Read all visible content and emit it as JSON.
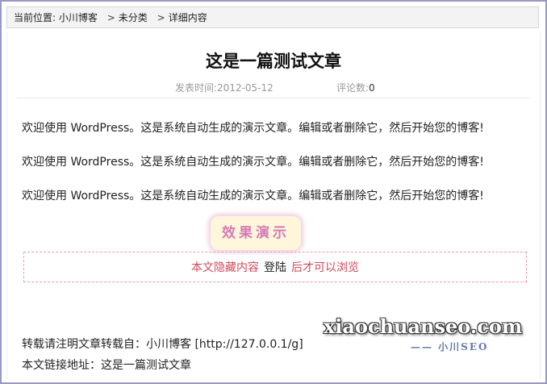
{
  "breadcrumb": {
    "prefix": "当前位置:",
    "home": "小川博客",
    "sep": ">",
    "category": "未分类",
    "current": "详细内容"
  },
  "article": {
    "title": "这是一篇测试文章",
    "date_label": "发表时间:",
    "date_value": "2012-05-12",
    "comments_label": "评论数:",
    "comments_value": "0",
    "paragraphs": [
      "欢迎使用 WordPress。这是系统自动生成的演示文章。编辑或者删除它，然后开始您的博客!",
      "欢迎使用 WordPress。这是系统自动生成的演示文章。编辑或者删除它，然后开始您的博客!",
      "欢迎使用 WordPress。这是系统自动生成的演示文章。编辑或者删除它，然后开始您的博客!"
    ],
    "demo_button": "效果演示",
    "hidden_prefix": "本文隐藏内容",
    "hidden_login": "登陆",
    "hidden_suffix": "后才可以浏览"
  },
  "footer": {
    "repost_text": "转载请注明文章转载自：小川博客 [http://127.0.0.1/g]",
    "link_text": "本文链接地址：这是一篇测试文章"
  },
  "watermark": {
    "main": "xiaochuanseo.com",
    "sub": "—— 小川SEO"
  },
  "colors": {
    "frame": "#9a98c8",
    "hidden_text": "#d14a5a",
    "demo_text": "#d67ab4"
  }
}
